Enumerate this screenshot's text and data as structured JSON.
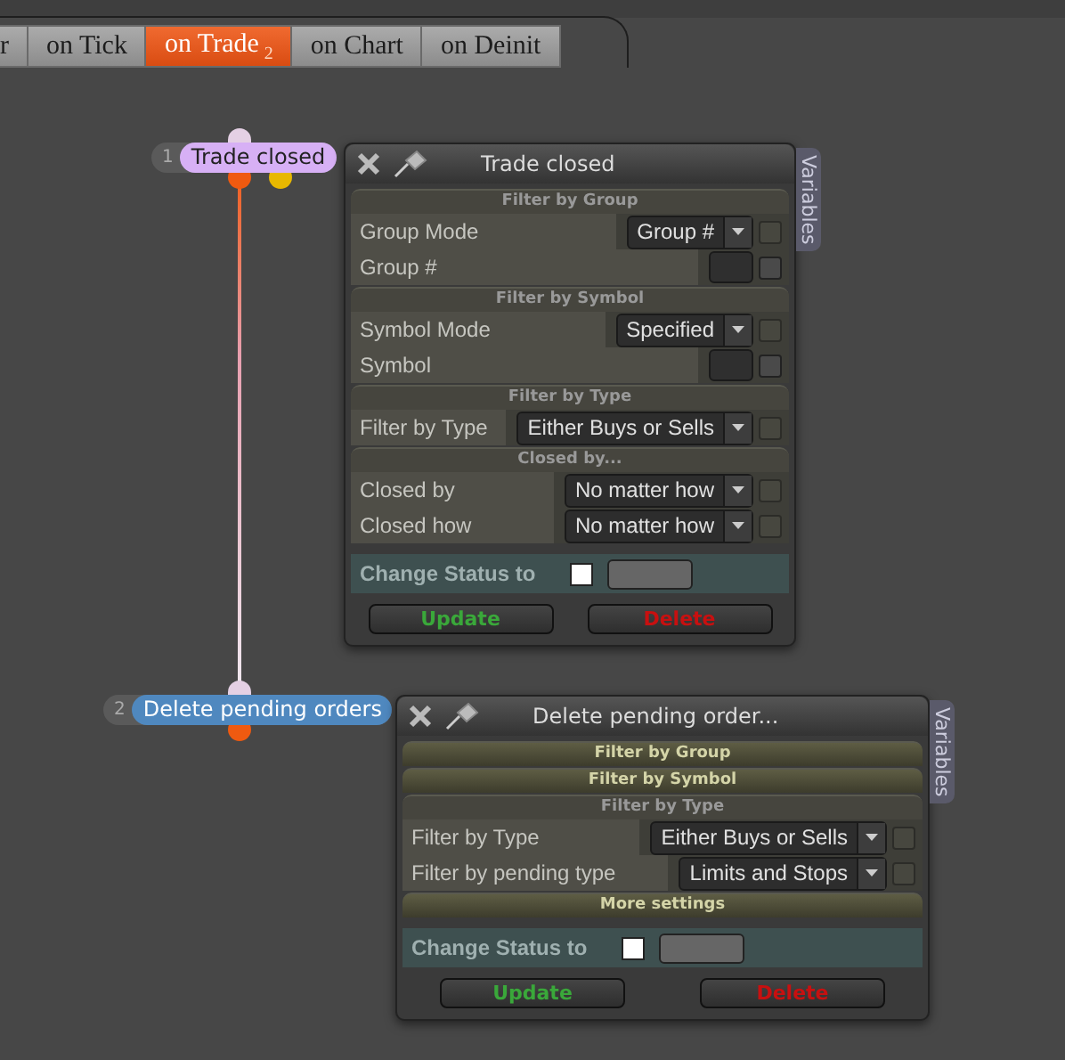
{
  "tabs": [
    {
      "label": "r",
      "selected": false
    },
    {
      "label": "on Tick",
      "selected": false
    },
    {
      "label": "on Trade",
      "badge": "2",
      "selected": true
    },
    {
      "label": "on Chart",
      "selected": false
    },
    {
      "label": "on Deinit",
      "selected": false
    }
  ],
  "nodes": [
    {
      "number": "1",
      "label": "Trade closed",
      "color": "#d7b0f5"
    },
    {
      "number": "2",
      "label": "Delete pending orders",
      "color": "#4f88bf"
    }
  ],
  "panels": [
    {
      "title": "Trade closed",
      "side_tab": "Variables",
      "sections": [
        {
          "title": "Filter by Group",
          "expanded": true,
          "rows": [
            {
              "label": "Group Mode",
              "kind": "select",
              "value": "Group #",
              "checked": false
            },
            {
              "label": "Group #",
              "kind": "input",
              "checked": false
            }
          ]
        },
        {
          "title": "Filter by Symbol",
          "expanded": true,
          "rows": [
            {
              "label": "Symbol Mode",
              "kind": "select",
              "value": "Specified",
              "checked": false
            },
            {
              "label": "Symbol",
              "kind": "input",
              "checked": false
            }
          ]
        },
        {
          "title": "Filter by Type",
          "expanded": true,
          "rows": [
            {
              "label": "Filter by Type",
              "kind": "select",
              "value": "Either Buys or Sells",
              "checked": false
            }
          ]
        },
        {
          "title": "Closed by...",
          "expanded": true,
          "rows": [
            {
              "label": "Closed by",
              "kind": "select",
              "value": "No matter how",
              "checked": false
            },
            {
              "label": "Closed how",
              "kind": "select",
              "value": "No matter how",
              "checked": false
            }
          ]
        }
      ],
      "status": {
        "label": "Change Status to",
        "checked": false
      },
      "buttons": [
        "Update",
        "Delete"
      ]
    },
    {
      "title": "Delete pending order...",
      "side_tab": "Variables",
      "sections": [
        {
          "title": "Filter by Group",
          "expanded": false
        },
        {
          "title": "Filter by Symbol",
          "expanded": false
        },
        {
          "title": "Filter by Type",
          "expanded": true,
          "rows": [
            {
              "label": "Filter by Type",
              "kind": "select",
              "value": "Either Buys or Sells",
              "checked": false
            },
            {
              "label": "Filter by pending type",
              "kind": "select",
              "value": "Limits and Stops",
              "checked": false
            }
          ]
        },
        {
          "title": "More settings",
          "expanded": false
        }
      ],
      "status": {
        "label": "Change Status to",
        "checked": false
      },
      "buttons": [
        "Update",
        "Delete"
      ]
    }
  ]
}
